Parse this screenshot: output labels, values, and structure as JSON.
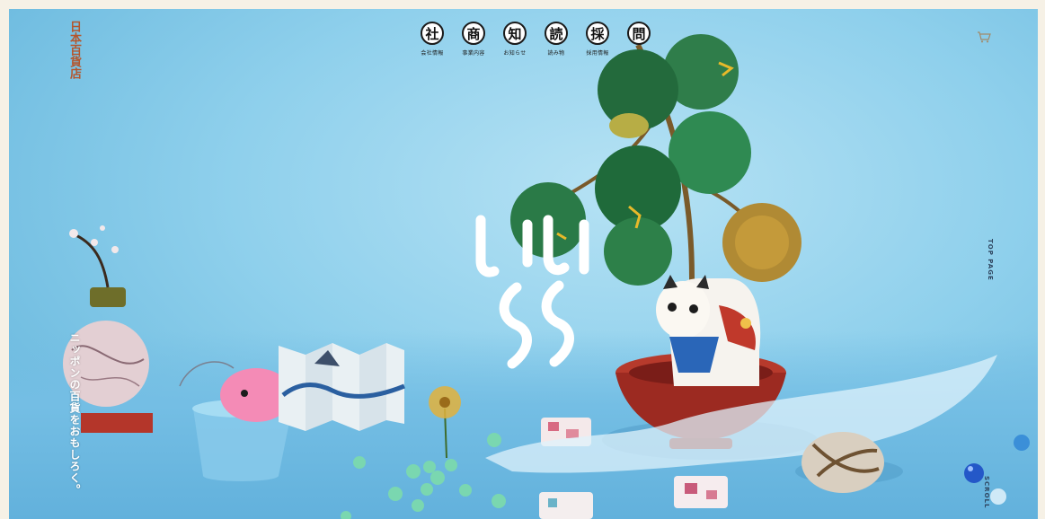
{
  "brand": {
    "name": "日本百貨店"
  },
  "nav": [
    {
      "glyph": "社",
      "label": "会社情報"
    },
    {
      "glyph": "商",
      "label": "事業内容"
    },
    {
      "glyph": "知",
      "label": "お知らせ"
    },
    {
      "glyph": "読",
      "label": "読み物"
    },
    {
      "glyph": "採",
      "label": "採用情報"
    },
    {
      "glyph": "問",
      "label": ""
    }
  ],
  "header": {
    "cart_icon": "cart-icon"
  },
  "side": {
    "top_page": "TOP PAGE",
    "scroll": "SCROLL"
  },
  "hero": {
    "tagline": "ニッポンの百貨をおもしろく。"
  },
  "colors": {
    "brand": "#b4562d",
    "sky": "#8fd0ec"
  }
}
